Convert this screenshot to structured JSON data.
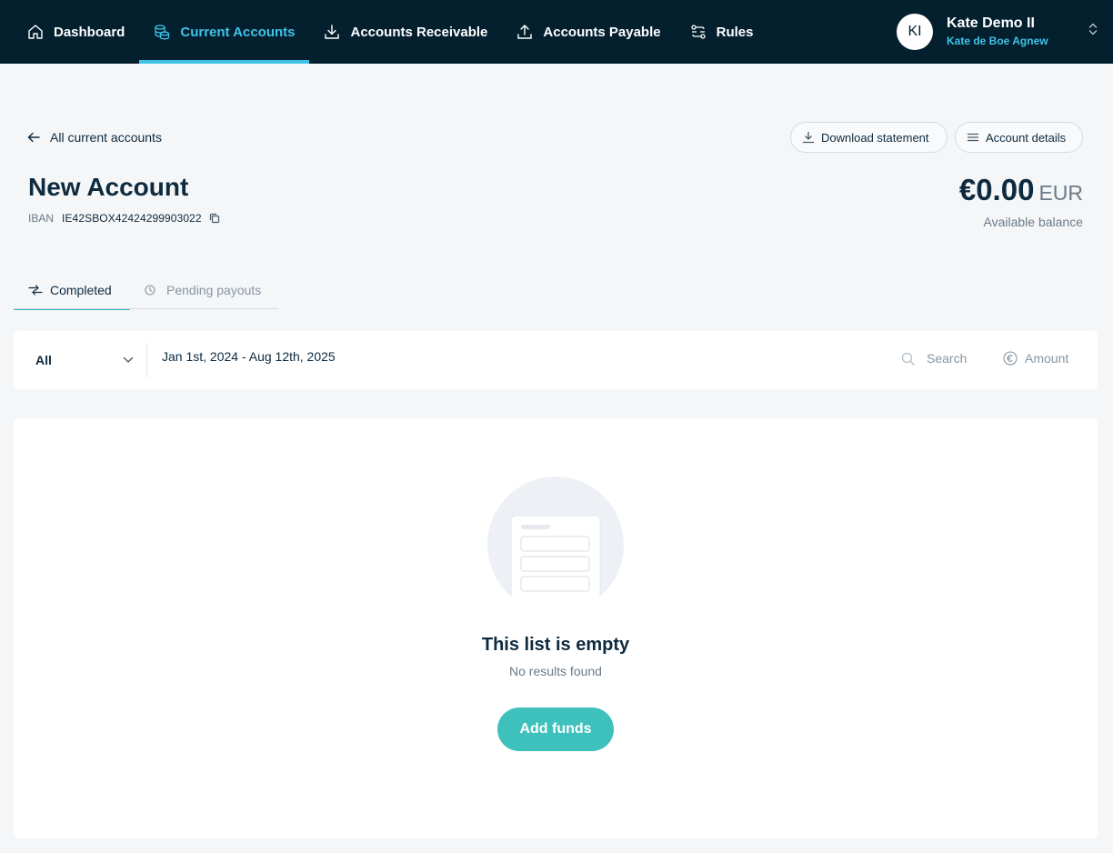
{
  "nav": {
    "items": [
      {
        "label": "Dashboard",
        "icon": "home-icon",
        "active": false
      },
      {
        "label": "Current Accounts",
        "icon": "coins-icon",
        "active": true
      },
      {
        "label": "Accounts Receivable",
        "icon": "download-icon",
        "active": false
      },
      {
        "label": "Accounts Payable",
        "icon": "upload-icon",
        "active": false
      },
      {
        "label": "Rules",
        "icon": "rules-icon",
        "active": false
      }
    ],
    "accent_color": "#3ec3e8",
    "background_color": "#04202f"
  },
  "user": {
    "initials": "KI",
    "name": "Kate Demo II",
    "subtitle": "Kate de Boe Agnew"
  },
  "header": {
    "back_label": "All current accounts",
    "download_label": "Download statement",
    "details_label": "Account details",
    "account_name": "New Account",
    "iban_label": "IBAN",
    "iban_value": "IE42SBOX42424299903022",
    "balance_amount": "€0.00",
    "balance_currency": "EUR",
    "balance_label": "Available balance"
  },
  "tabs": {
    "completed": "Completed",
    "pending": "Pending payouts"
  },
  "filters": {
    "type_selected": "All",
    "date_range": "Jan 1st, 2024 - Aug 12th, 2025",
    "search_placeholder": "Search",
    "amount_label": "Amount"
  },
  "empty_state": {
    "title": "This list is empty",
    "subtitle": "No results found",
    "button_label": "Add funds",
    "button_color": "#3ec0bc"
  }
}
